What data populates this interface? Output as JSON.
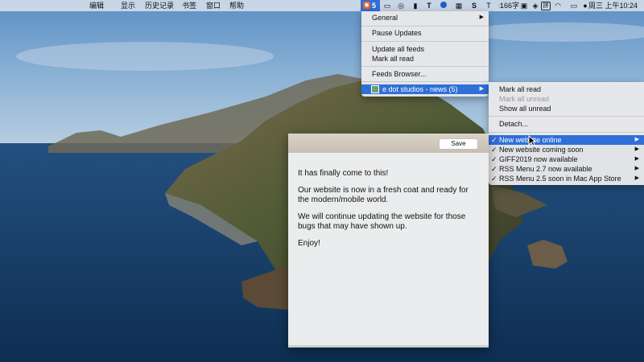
{
  "menubar": {
    "app_menus": [
      "编辑",
      "显示",
      "历史记录",
      "书签",
      "窗口",
      "帮助"
    ],
    "rss_badge": "5",
    "status_icons": [
      "rss-icon",
      "facetime-icon",
      "wechat-icon",
      "bookmark-icon",
      "text-t-icon",
      "dot-icon",
      "grid-icon",
      "scrivener-s-icon",
      "typora-t-icon",
      "chat-icon"
    ],
    "word_count": "166字",
    "input_method": "拼",
    "date_time": "周三 上午10:24"
  },
  "rss_menu": {
    "items": [
      {
        "label": "General",
        "submenu": true
      },
      {
        "label": "Pause Updates"
      },
      {
        "label": "Update all feeds"
      },
      {
        "label": "Mark all read"
      },
      {
        "label": "Feeds Browser..."
      },
      {
        "label": "e dot studios - news (5)",
        "submenu": true,
        "highlighted": true
      }
    ]
  },
  "feed_submenu": {
    "items": [
      {
        "label": "Mark all read"
      },
      {
        "label": "Mark all unread",
        "disabled": true
      },
      {
        "label": "Show all unread"
      },
      {
        "label": "Detach..."
      },
      {
        "label": "New website online",
        "checked": true,
        "highlighted": true
      },
      {
        "label": "New website coming soon",
        "checked": true
      },
      {
        "label": "GIFF2019 now available",
        "checked": true
      },
      {
        "label": "RSS Menu 2.7 now available",
        "checked": true
      },
      {
        "label": "RSS Menu 2.5 soon in Mac App Store",
        "checked": true
      }
    ]
  },
  "note": {
    "save_label": "Save",
    "paragraphs": [
      "It has finally come to this!",
      "Our website is now in a fresh coat and ready for the modern/mobile world.",
      "We will continue updating the website for those bugs that may have shown up.",
      "Enjoy!"
    ]
  },
  "colors": {
    "highlight": "#2f6fd8",
    "rss_orange": "#e8632b"
  }
}
